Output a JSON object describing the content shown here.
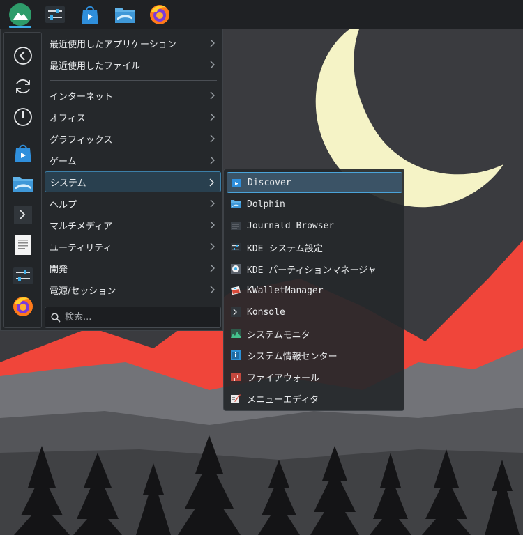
{
  "panel": {
    "launchers": [
      {
        "name": "application-launcher-icon"
      },
      {
        "name": "system-settings-icon"
      },
      {
        "name": "discover-icon"
      },
      {
        "name": "dolphin-icon"
      },
      {
        "name": "firefox-icon"
      }
    ]
  },
  "favorites": [
    {
      "name": "back-icon"
    },
    {
      "name": "reboot-icon"
    },
    {
      "name": "power-icon"
    },
    {
      "name": "discover-icon"
    },
    {
      "name": "dolphin-icon"
    },
    {
      "name": "konsole-icon"
    },
    {
      "name": "text-editor-icon"
    },
    {
      "name": "system-settings-icon"
    },
    {
      "name": "firefox-icon"
    }
  ],
  "categories": [
    {
      "label": "最近使用したアプリケーション"
    },
    {
      "label": "最近使用したファイル"
    },
    {
      "label": "インターネット"
    },
    {
      "label": "オフィス"
    },
    {
      "label": "グラフィックス"
    },
    {
      "label": "ゲーム"
    },
    {
      "label": "システム"
    },
    {
      "label": "ヘルプ"
    },
    {
      "label": "マルチメディア"
    },
    {
      "label": "ユーティリティ"
    },
    {
      "label": "開発"
    },
    {
      "label": "電源/セッション"
    }
  ],
  "selected_category": "システム",
  "search": {
    "placeholder": "検索..."
  },
  "system_submenu": [
    {
      "label": "Discover",
      "icon": "discover-icon"
    },
    {
      "label": "Dolphin",
      "icon": "dolphin-icon"
    },
    {
      "label": "Journald Browser",
      "icon": "journald-browser-icon"
    },
    {
      "label": "KDE システム設定",
      "icon": "system-settings-icon"
    },
    {
      "label": "KDE パーティションマネージャ",
      "icon": "partition-manager-icon"
    },
    {
      "label": "KWalletManager",
      "icon": "kwallet-icon"
    },
    {
      "label": "Konsole",
      "icon": "konsole-icon"
    },
    {
      "label": "システムモニタ",
      "icon": "system-monitor-icon"
    },
    {
      "label": "システム情報センター",
      "icon": "info-center-icon"
    },
    {
      "label": "ファイアウォール",
      "icon": "firewall-icon"
    },
    {
      "label": "メニューエディタ",
      "icon": "menu-editor-icon"
    }
  ],
  "colors": {
    "accent": "#3daee9",
    "moon": "#f5f3c6",
    "mountain_red": "#f0453a",
    "panel_bg": "#1f2124"
  }
}
